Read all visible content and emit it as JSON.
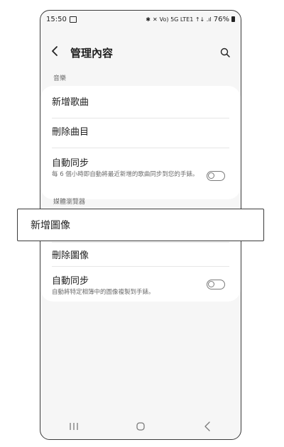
{
  "status_bar": {
    "time": "15:50",
    "network_text": "Vo) 5G LTE1 ↑↓ .ıl",
    "battery_pct": "76%"
  },
  "app_bar": {
    "title": "管理內容"
  },
  "music_section": {
    "header": "音樂",
    "items": [
      {
        "label": "新增歌曲"
      },
      {
        "label": "刪除曲目"
      }
    ],
    "auto_sync": {
      "label": "自動同步",
      "description": "每 6 個小時即自動將最近新增的歌曲同步到您的手錶。",
      "enabled": false
    }
  },
  "media_section": {
    "header": "媒體瀏覽器",
    "items": [
      {
        "label": "刪除圖像"
      }
    ],
    "auto_sync": {
      "label": "自動同步",
      "description": "自動將特定相簿中的圖像複製到手錶。",
      "enabled": false
    }
  },
  "highlight_popup": {
    "label": "新增圖像"
  },
  "icons": {
    "back": "back-icon",
    "search": "search-icon",
    "recents": "recents-icon",
    "home": "home-icon",
    "nav_back": "nav-back-icon"
  },
  "colors": {
    "background": "#f6f6f6",
    "card": "#ffffff",
    "text_primary": "#1f1f1f",
    "text_secondary": "#6c6c6c",
    "toggle_off": "#7a7a7a"
  }
}
